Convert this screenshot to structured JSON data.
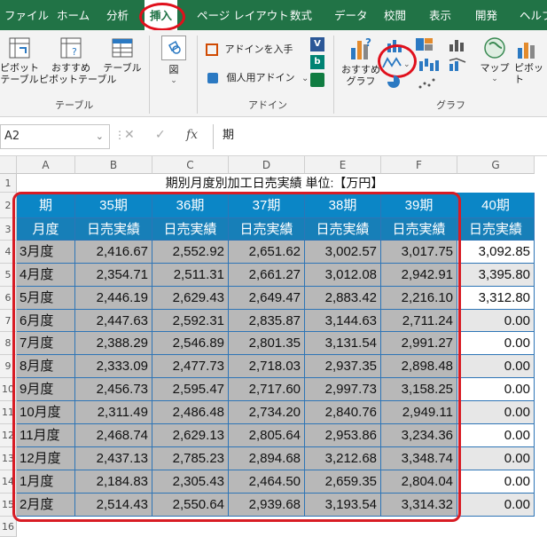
{
  "ribbon_tabs": [
    "ファイル",
    "ホーム",
    "分析",
    "挿入",
    "ページ レイアウト",
    "数式",
    "データ",
    "校閲",
    "表示",
    "開発",
    "ヘルプ"
  ],
  "active_tab": "挿入",
  "ribbon": {
    "pivot_table": "ピボット\nテーブル",
    "recommended_pivot": "おすすめ\nピボットテーブル",
    "table": "テーブル",
    "illustrations": "図",
    "get_addins": "アドインを入手",
    "my_addins": "個人用アドイン",
    "recommended_charts": "おすすめ\nグラフ",
    "maps": "マップ",
    "pivot_chart": "ピボット",
    "group_table": "テーブル",
    "group_addins": "アドイン",
    "group_charts": "グラフ"
  },
  "icons": [
    "pivot-table-icon",
    "recommended-pivot-icon",
    "table-icon",
    "illustrations-icon",
    "store-icon",
    "my-addins-icon",
    "visio-icon",
    "bing-icon",
    "people-graph-icon",
    "recommended-charts-icon",
    "column-chart-icon",
    "line-chart-icon",
    "hierarchy-chart-icon",
    "waterfall-chart-icon",
    "pie-chart-icon",
    "scatter-chart-icon",
    "map-icon",
    "pivot-chart-icon"
  ],
  "formula_bar": {
    "name_box": "A2",
    "fx": "fx",
    "formula": "期"
  },
  "columns": [
    "A",
    "B",
    "C",
    "D",
    "E",
    "F",
    "G"
  ],
  "rows": [
    "1",
    "2",
    "3",
    "4",
    "5",
    "6",
    "7",
    "8",
    "9",
    "10",
    "11",
    "12",
    "13",
    "14",
    "15",
    "16"
  ],
  "sheet": {
    "title": "期別月度別加工日売実績 単位:【万円】",
    "header_row1": [
      "期",
      "35期",
      "36期",
      "37期",
      "38期",
      "39期",
      "40期"
    ],
    "header_row2": [
      "月度",
      "日売実績",
      "日売実績",
      "日売実績",
      "日売実績",
      "日売実績",
      "日売実績"
    ],
    "months": [
      "3月度",
      "4月度",
      "5月度",
      "6月度",
      "7月度",
      "8月度",
      "9月度",
      "10月度",
      "11月度",
      "12月度",
      "1月度",
      "2月度"
    ],
    "values": [
      [
        "2,416.67",
        "2,552.92",
        "2,651.62",
        "3,002.57",
        "3,017.75",
        "3,092.85"
      ],
      [
        "2,354.71",
        "2,511.31",
        "2,661.27",
        "3,012.08",
        "2,942.91",
        "3,395.80"
      ],
      [
        "2,446.19",
        "2,629.43",
        "2,649.47",
        "2,883.42",
        "2,216.10",
        "3,312.80"
      ],
      [
        "2,447.63",
        "2,592.31",
        "2,835.87",
        "3,144.63",
        "2,711.24",
        "0.00"
      ],
      [
        "2,388.29",
        "2,546.89",
        "2,801.35",
        "3,131.54",
        "2,991.27",
        "0.00"
      ],
      [
        "2,333.09",
        "2,477.73",
        "2,718.03",
        "2,937.35",
        "2,898.48",
        "0.00"
      ],
      [
        "2,456.73",
        "2,595.47",
        "2,717.60",
        "2,997.73",
        "3,158.25",
        "0.00"
      ],
      [
        "2,311.49",
        "2,486.48",
        "2,734.20",
        "2,840.76",
        "2,949.11",
        "0.00"
      ],
      [
        "2,468.74",
        "2,629.13",
        "2,805.64",
        "2,953.86",
        "3,234.36",
        "0.00"
      ],
      [
        "2,437.13",
        "2,785.23",
        "2,894.68",
        "3,212.68",
        "3,348.74",
        "0.00"
      ],
      [
        "2,184.83",
        "2,305.43",
        "2,464.50",
        "2,659.35",
        "2,804.04",
        "0.00"
      ],
      [
        "2,514.43",
        "2,550.64",
        "2,939.68",
        "3,193.54",
        "3,314.32",
        "0.00"
      ]
    ]
  },
  "colors": {
    "ribbon_green": "#217346",
    "header_blue": "#0b86c6",
    "highlight_red": "#e0101c",
    "selected_gray": "#b8b8b8"
  }
}
